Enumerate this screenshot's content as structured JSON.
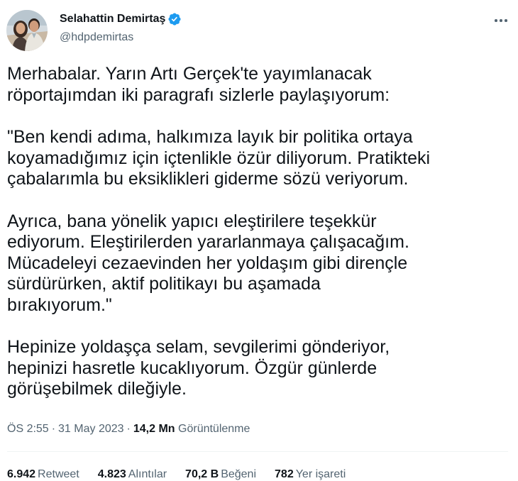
{
  "author": {
    "display_name": "Selahattin Demirtaş",
    "handle": "@hdpdemirtas",
    "verified_badge_icon": "verified-badge-icon",
    "avatar_icon": "avatar-photo"
  },
  "more_icon": "more-horizontal-icon",
  "tweet": {
    "paragraphs": [
      [
        "Merhabalar. Yarın Artı Gerçek'te yayımlanacak",
        "röportajımdan iki paragrafı sizlerle paylaşıyorum:"
      ],
      [
        "\"Ben kendi adıma, halkımıza layık bir politika ortaya",
        "koyamadığımız için içtenlikle özür diliyorum. Pratikteki",
        "çabalarımla bu eksiklikleri giderme sözü veriyorum."
      ],
      [
        "Ayrıca, bana yönelik yapıcı eleştirilere teşekkür",
        "ediyorum. Eleştirilerden yararlanmaya çalışacağım.",
        "Mücadeleyi cezaevinden her yoldaşım gibi dirençle",
        "sürdürürken, aktif politikayı bu aşamada",
        "bırakıyorum.\""
      ],
      [
        "Hepinize yoldaşça selam, sevgilerimi gönderiyor,",
        "hepinizi hasretle kucaklıyorum. Özgür günlerde",
        "görüşebilmek dileğiyle."
      ]
    ]
  },
  "meta": {
    "time": "ÖS 2:55",
    "separator": "·",
    "date": "31 May 2023",
    "views_count": "14,2 Mn",
    "views_label": "Görüntülenme"
  },
  "stats": [
    {
      "count": "6.942",
      "label": "Retweet"
    },
    {
      "count": "4.823",
      "label": "Alıntılar"
    },
    {
      "count": "70,2 B",
      "label": "Beğeni"
    },
    {
      "count": "782",
      "label": "Yer işareti"
    }
  ],
  "colors": {
    "text_primary": "#0f1419",
    "text_secondary": "#536471",
    "verified_blue": "#1d9bf0",
    "divider": "#eff3f4"
  }
}
